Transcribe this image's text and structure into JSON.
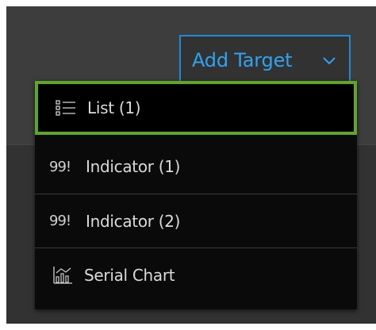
{
  "add_target": {
    "label": "Add Target"
  },
  "menu": {
    "items": [
      {
        "label": "List (1)",
        "icon": "list-icon",
        "selected": true
      },
      {
        "label": "Indicator (1)",
        "icon_text": "99!",
        "icon": "indicator-icon"
      },
      {
        "label": "Indicator (2)",
        "icon_text": "99!",
        "icon": "indicator-icon"
      },
      {
        "label": "Serial Chart",
        "icon": "serial-chart-icon"
      }
    ]
  },
  "colors": {
    "accent_blue": "#2ea3f2",
    "selected_green": "#5fa52b",
    "panel_bg": "#323232",
    "menu_bg": "#0a0a0a"
  }
}
